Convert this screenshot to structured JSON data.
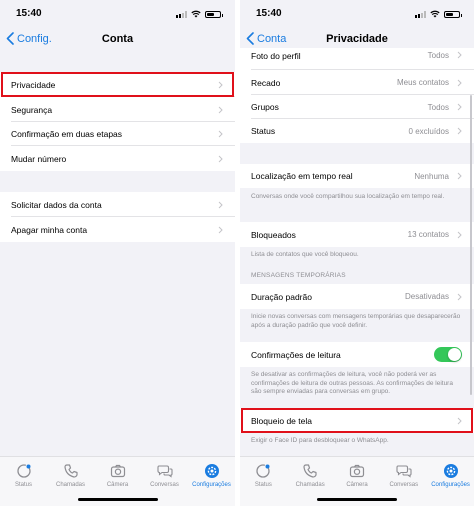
{
  "left": {
    "status_time": "15:40",
    "back_label": "Config.",
    "title": "Conta",
    "items": [
      {
        "label": "Privacidade"
      },
      {
        "label": "Segurança"
      },
      {
        "label": "Confirmação em duas etapas"
      },
      {
        "label": "Mudar número"
      },
      {
        "label": "Solicitar dados da conta"
      },
      {
        "label": "Apagar minha conta"
      }
    ]
  },
  "right": {
    "status_time": "15:40",
    "back_label": "Conta",
    "title": "Privacidade",
    "items": [
      {
        "label": "Foto do perfil",
        "value": "Todos"
      },
      {
        "label": "Recado",
        "value": "Meus contatos"
      },
      {
        "label": "Grupos",
        "value": "Todos"
      },
      {
        "label": "Status",
        "value": "0 excluídos"
      },
      {
        "label": "Localização em tempo real",
        "value": "Nenhuma"
      },
      {
        "label": "Bloqueados",
        "value": "13 contatos"
      },
      {
        "label": "Duração padrão",
        "value": "Desativadas"
      },
      {
        "label": "Confirmações de leitura",
        "value": true
      },
      {
        "label": "Bloqueio de tela"
      }
    ],
    "notes": {
      "location": "Conversas onde você compartilhou sua localização em tempo real.",
      "blocked": "Lista de contatos que você bloqueou.",
      "disappearing_header": "MENSAGENS TEMPORÁRIAS",
      "disappearing": "Inicie novas conversas com mensagens temporárias que desaparecerão após a duração padrão que você definir.",
      "read_receipts": "Se desativar as confirmações de leitura, você não poderá ver as confirmações de leitura de outras pessoas. As confirmações de leitura são sempre enviadas para conversas em grupo.",
      "screen_lock": "Exigir o Face ID para desbloquear o WhatsApp."
    }
  },
  "tabbar": {
    "tabs": [
      {
        "label": "Status",
        "icon": "status-icon"
      },
      {
        "label": "Chamadas",
        "icon": "phone-icon"
      },
      {
        "label": "Câmera",
        "icon": "camera-icon"
      },
      {
        "label": "Conversas",
        "icon": "chat-bubbles-icon"
      },
      {
        "label": "Configurações",
        "icon": "gear-icon"
      }
    ]
  },
  "colors": {
    "accent": "#1a7ce0",
    "highlight": "#e0101a",
    "toggle_on": "#34c759",
    "background": "#f2f2f7"
  }
}
